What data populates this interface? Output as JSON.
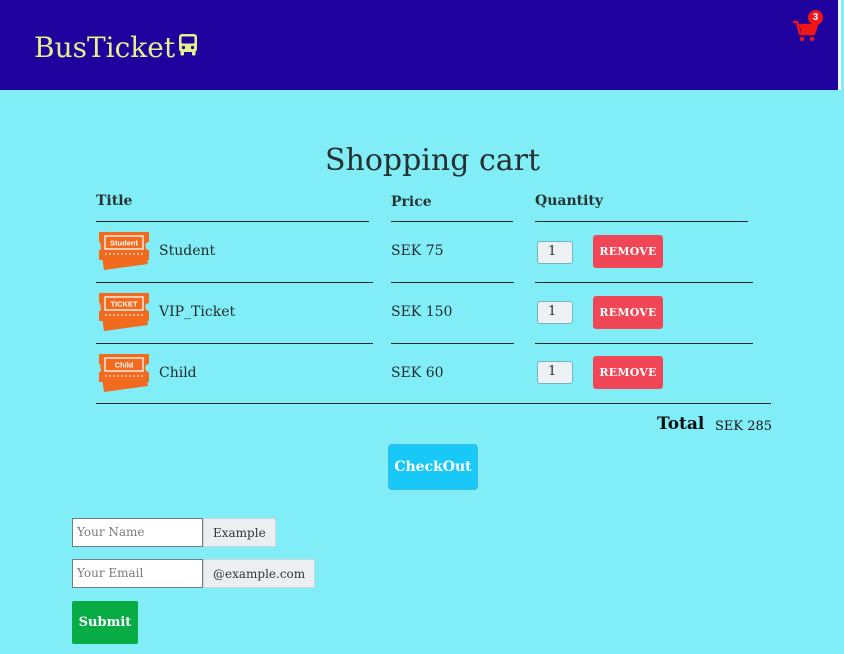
{
  "nav": {
    "brand": "BusTicket",
    "brand_icon": "bus-icon",
    "cart_icon": "shopping-cart-icon",
    "cart_count": "3",
    "colors": {
      "background": "#1f029e",
      "brand": "#e3f08b",
      "cart": "#f01616"
    }
  },
  "cart": {
    "title": "Shopping cart",
    "columns": {
      "title": "Title",
      "price": "Price",
      "quantity": "Quantity"
    },
    "items": [
      {
        "title": "Student",
        "ticket_label": "Student",
        "price": "SEK 75",
        "quantity": "1",
        "remove_label": "REMOVE"
      },
      {
        "title": "VIP_Ticket",
        "ticket_label": "TICKET",
        "price": "SEK 150",
        "quantity": "1",
        "remove_label": "REMOVE"
      },
      {
        "title": "Child",
        "ticket_label": "Child",
        "price": "SEK 60",
        "quantity": "1",
        "remove_label": "REMOVE"
      }
    ],
    "total_label": "Total",
    "total_value": "SEK 285",
    "checkout_label": "CheckOut"
  },
  "form": {
    "name_placeholder": "Your Name",
    "name_addon": "Example",
    "email_placeholder": "Your Email",
    "email_addon": "@example.com",
    "submit_label": "Submit"
  },
  "colors": {
    "page_background": "#80edf7",
    "remove_button": "#f04655",
    "checkout_button": "#18c8f7",
    "submit_button": "#07ac45",
    "ticket_icon": "#f26a1e"
  }
}
